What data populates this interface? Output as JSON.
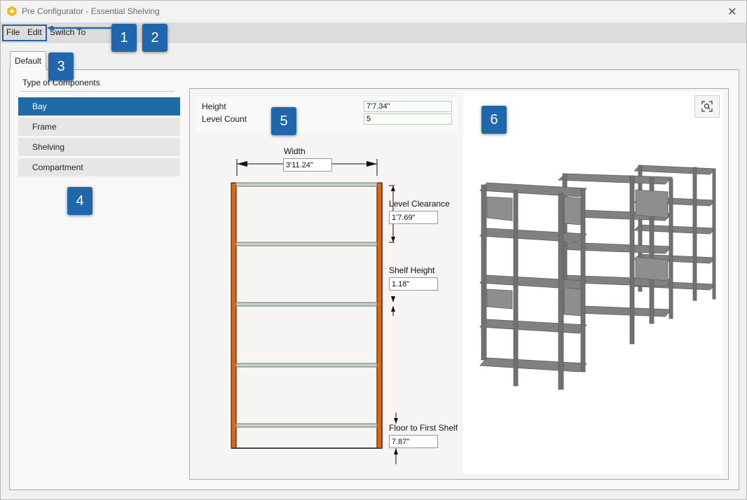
{
  "window": {
    "title": "Pre Configurator - Essential Shelving",
    "close_glyph": "✕"
  },
  "menu": {
    "file": "File",
    "edit": "Edit",
    "switch_to": "Switch To"
  },
  "tabs": [
    {
      "label": "Default",
      "active": true
    }
  ],
  "components": {
    "header": "Type of Components",
    "items": [
      {
        "label": "Bay",
        "selected": true
      },
      {
        "label": "Frame",
        "selected": false
      },
      {
        "label": "Shelving",
        "selected": false
      },
      {
        "label": "Compartment",
        "selected": false
      }
    ]
  },
  "properties": {
    "height_label": "Height",
    "height_value": "7'7.34\"",
    "level_count_label": "Level Count",
    "level_count_value": "5"
  },
  "diagram": {
    "width_label": "Width",
    "width_value": "3'11.24\"",
    "level_clearance_label": "Level Clearance",
    "level_clearance_value": "1'7.69\"",
    "shelf_height_label": "Shelf Height",
    "shelf_height_value": "1.18\"",
    "floor_first_label": "Floor to First Shelf",
    "floor_first_value": "7.87\""
  },
  "callouts": [
    "1",
    "2",
    "3",
    "4",
    "5",
    "6"
  ],
  "colors": {
    "accent": "#1f66ad",
    "selected": "#1e6ba8",
    "upright": "#e8620f",
    "shelf": "#c7d0c6",
    "shelf_3d": "#808283"
  },
  "icons": {
    "app": "hex-logo-icon",
    "zoom": "zoom-fit-icon",
    "close": "close-icon"
  }
}
